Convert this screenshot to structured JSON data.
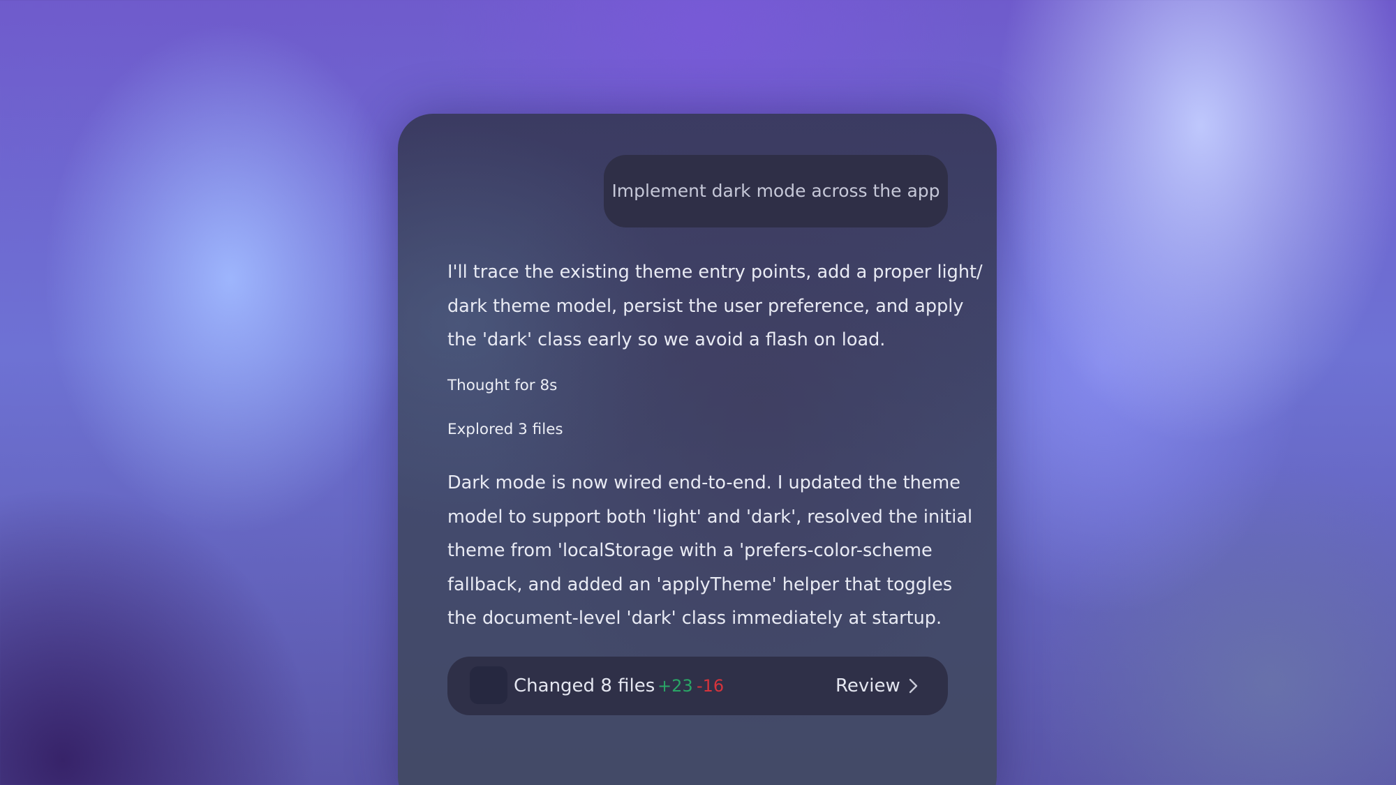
{
  "conversation": {
    "user_message": "Implement dark mode across the app",
    "assistant_intro": [
      "I'll trace the existing theme entry points, add a proper light/",
      "dark theme model, persist the user preference, and apply",
      "the 'dark' class early so we avoid a flash on load."
    ],
    "thought_label": "Thought for 8s",
    "explored_label": "Explored 3 files",
    "assistant_summary": [
      "Dark mode is now wired end-to-end. I updated the theme",
      "model to support both 'light' and 'dark', resolved the initial",
      "theme from 'localStorage with a 'prefers-color-scheme",
      "fallback, and added an 'applyTheme' helper that toggles",
      "the document-level 'dark' class immediately at startup."
    ]
  },
  "changes": {
    "label": "Changed 8 files",
    "additions": "+23",
    "deletions": "-16",
    "review_label": "Review",
    "icons": {
      "file": "file-icon",
      "chevron": "chevron-right-icon"
    }
  },
  "colors": {
    "additions": "#2aa566",
    "deletions": "#d5343c",
    "panel": "#3f4466",
    "bubble": "#2f2f47"
  }
}
